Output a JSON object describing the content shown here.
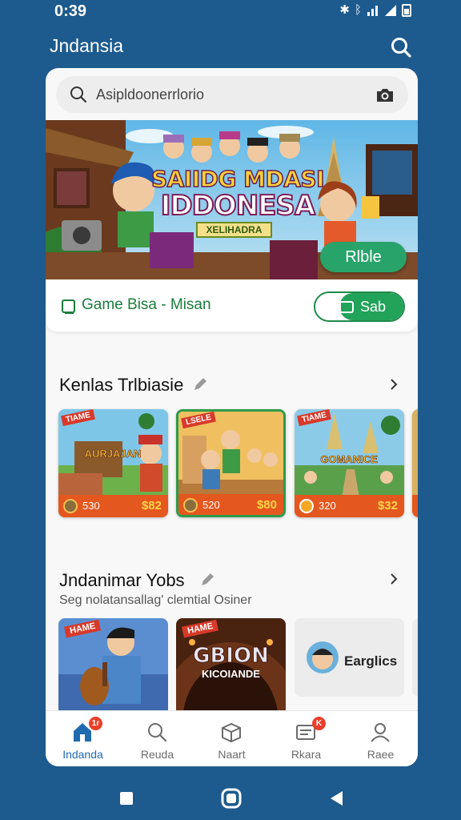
{
  "status": {
    "time": "0:39"
  },
  "header": {
    "title": "Jndansia"
  },
  "search": {
    "placeholder": "Asipldoonerrlorio"
  },
  "banner": {
    "line1": "SAIIDG MDASI",
    "line2": "IDDONESA",
    "tag": "XELIHADRA",
    "button": "Rlble"
  },
  "promo": {
    "label": "Game Bisa - Misan",
    "toggle_label": "Sab"
  },
  "section1": {
    "title": "Kenlas Trlbiasie",
    "cards": [
      {
        "badge": "TIAME",
        "title": "AURJAJAN",
        "price": "530",
        "old": "$82"
      },
      {
        "badge": "LSELE",
        "title": "",
        "price": "520",
        "old": "$80"
      },
      {
        "badge": "TIAME",
        "title": "GOMANICE",
        "price": "320",
        "old": "$32"
      }
    ]
  },
  "section2": {
    "title": "Jndanimar Yobs",
    "subtitle": "Seg nolatansallag' clemtial Osiner",
    "cards": [
      {
        "badge": "HAME",
        "title": "",
        "sub": ""
      },
      {
        "badge": "HAME",
        "title": "GBION",
        "sub": "KICOIANDE"
      },
      {
        "badge": "",
        "title": "Earglics",
        "sub": ""
      }
    ]
  },
  "nav": {
    "items": [
      {
        "label": "Indanda",
        "badge": "1r"
      },
      {
        "label": "Reuda",
        "badge": ""
      },
      {
        "label": "Naart",
        "badge": ""
      },
      {
        "label": "Rkara",
        "badge": "K"
      },
      {
        "label": "Raee",
        "badge": ""
      }
    ]
  },
  "colors": {
    "primary": "#1d5a8e",
    "accent_green": "#22a35a",
    "active_nav": "#1f6bb0",
    "badge_red": "#e8402a"
  }
}
